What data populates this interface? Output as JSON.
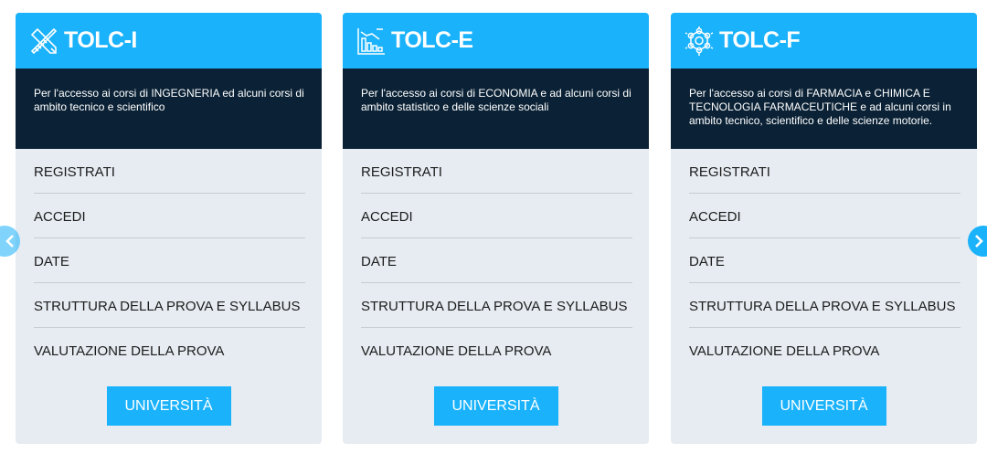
{
  "cards": [
    {
      "title": "TOLC-I",
      "icon": "tools-icon",
      "description": "Per l'accesso ai corsi di INGEGNERIA ed alcuni corsi di ambito tecnico e scientifico",
      "menu": [
        "REGISTRATI",
        "ACCEDI",
        "DATE",
        "STRUTTURA DELLA PROVA E SYLLABUS",
        "VALUTAZIONE DELLA PROVA"
      ],
      "button": "UNIVERSITÀ"
    },
    {
      "title": "TOLC-E",
      "icon": "bar-chart-icon",
      "description": "Per l'accesso ai corsi di ECONOMIA e ad alcuni corsi di ambito statistico e delle scienze sociali",
      "menu": [
        "REGISTRATI",
        "ACCEDI",
        "DATE",
        "STRUTTURA DELLA PROVA E SYLLABUS",
        "VALUTAZIONE DELLA PROVA"
      ],
      "button": "UNIVERSITÀ"
    },
    {
      "title": "TOLC-F",
      "icon": "molecule-icon",
      "description": "Per l'accesso ai corsi di FARMACIA e CHIMICA E TECNOLOGIA FARMACEUTICHE e ad alcuni corsi in ambito tecnico, scientifico e delle scienze motorie.",
      "menu": [
        "REGISTRATI",
        "ACCEDI",
        "DATE",
        "STRUTTURA DELLA PROVA E SYLLABUS",
        "VALUTAZIONE DELLA PROVA"
      ],
      "button": "UNIVERSITÀ"
    }
  ],
  "carousel": {
    "prev_icon": "chevron-left-icon",
    "next_icon": "chevron-right-icon"
  },
  "colors": {
    "accent": "#1ab2fb",
    "dark": "#0b2236",
    "card_bg": "#e6ecf2"
  }
}
